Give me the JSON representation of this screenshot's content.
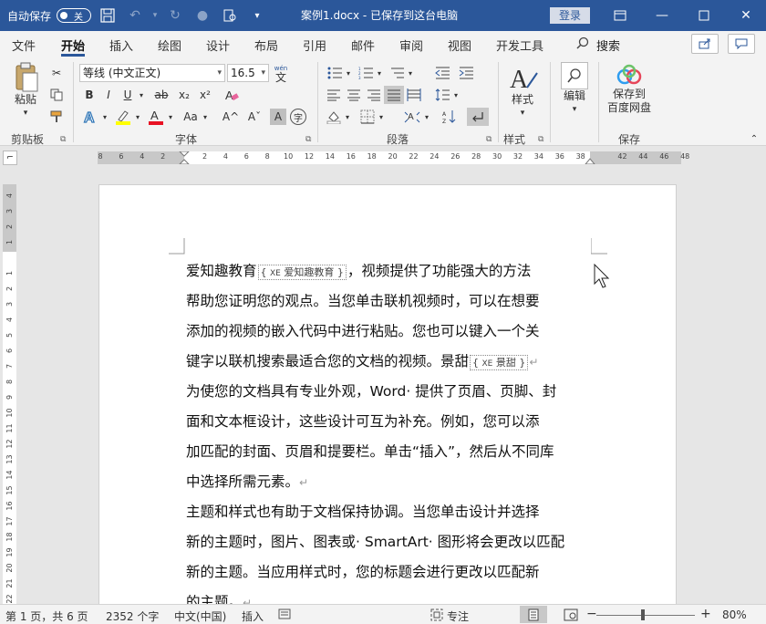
{
  "titlebar": {
    "autosave_label": "自动保存",
    "autosave_state": "关",
    "doc_title": "案例1.docx  -  已保存到这台电脑",
    "login_label": "登录"
  },
  "tabs": [
    "文件",
    "开始",
    "插入",
    "绘图",
    "设计",
    "布局",
    "引用",
    "邮件",
    "审阅",
    "视图",
    "开发工具"
  ],
  "active_tab": "开始",
  "search_label": "搜索",
  "ribbon": {
    "paste_label": "粘贴",
    "clipboard_group": "剪贴板",
    "font_name": "等线 (中文正文)",
    "font_size": "16.5",
    "font_group": "字体",
    "paragraph_group": "段落",
    "styles_label": "样式",
    "styles_group": "样式",
    "edit_label": "编辑",
    "save_baidu_line1": "保存到",
    "save_baidu_line2": "百度网盘",
    "save_group": "保存",
    "pinyin_top": "wén",
    "pinyin_char": "文",
    "bold": "B",
    "italic": "I",
    "underline": "U",
    "strike": "ab",
    "subscript": "x₂",
    "superscript": "x²",
    "font_color_a": "A",
    "change_case": "Aa",
    "grow_font": "A^",
    "shrink_font": "Aˇ",
    "char_shade": "A",
    "enclose_char": "字"
  },
  "ruler": {
    "h_ticks": [
      "8",
      "6",
      "4",
      "2",
      "",
      "2",
      "4",
      "6",
      "8",
      "10",
      "12",
      "14",
      "16",
      "18",
      "20",
      "22",
      "24",
      "26",
      "28",
      "30",
      "32",
      "34",
      "36",
      "38",
      "",
      "42",
      "44",
      "46",
      "48"
    ],
    "v_ticks": [
      "4",
      "3",
      "2",
      "1",
      "",
      "1",
      "2",
      "3",
      "4",
      "5",
      "6",
      "7",
      "8",
      "9",
      "10",
      "11",
      "12",
      "13",
      "14",
      "15",
      "16",
      "17",
      "18",
      "19",
      "20",
      "21",
      "22"
    ]
  },
  "document": {
    "lines": [
      {
        "pre": "爱知趣教育",
        "field": "爱知趣教育",
        "post": "，视频提供了功能强大的方法",
        "mark": ""
      },
      {
        "pre": "帮助您证明您的观点。当您单击联机视频时，可以在想要",
        "field": "",
        "post": "",
        "mark": ""
      },
      {
        "pre": "添加的视频的嵌入代码中进行粘贴。您也可以键入一个关",
        "field": "",
        "post": "",
        "mark": ""
      },
      {
        "pre": "键字以联机搜索最适合您的文档的视频。景甜",
        "field": "景甜",
        "post": "",
        "mark": "↵"
      },
      {
        "pre": "为使您的文档具有专业外观，Word· 提供了页眉、页脚、封",
        "field": "",
        "post": "",
        "mark": ""
      },
      {
        "pre": "面和文本框设计，这些设计可互为补充。例如，您可以添",
        "field": "",
        "post": "",
        "mark": ""
      },
      {
        "pre": "加匹配的封面、页眉和提要栏。单击“插入”，然后从不同库",
        "field": "",
        "post": "",
        "mark": ""
      },
      {
        "pre": "中选择所需元素。",
        "field": "",
        "post": "",
        "mark": "↵"
      },
      {
        "pre": "主题和样式也有助于文档保持协调。当您单击设计并选择",
        "field": "",
        "post": "",
        "mark": ""
      },
      {
        "pre": "新的主题时，图片、图表或· SmartArt· 图形将会更改以匹配",
        "field": "",
        "post": "",
        "mark": ""
      },
      {
        "pre": "新的主题。当应用样式时，您的标题会进行更改以匹配新",
        "field": "",
        "post": "",
        "mark": ""
      },
      {
        "pre": "的主题。",
        "field": "",
        "post": "",
        "mark": "↵"
      }
    ],
    "field_code": "XE"
  },
  "statusbar": {
    "page": "第 1 页，共 6 页",
    "words": "2352 个字",
    "language": "中文(中国)",
    "mode": "插入",
    "focus": "专注",
    "zoom": "80%",
    "minus": "−",
    "plus": "+"
  },
  "colors": {
    "title_bar": "#2b579a",
    "highlight": "#ffff00",
    "font_color": "#e81123"
  }
}
